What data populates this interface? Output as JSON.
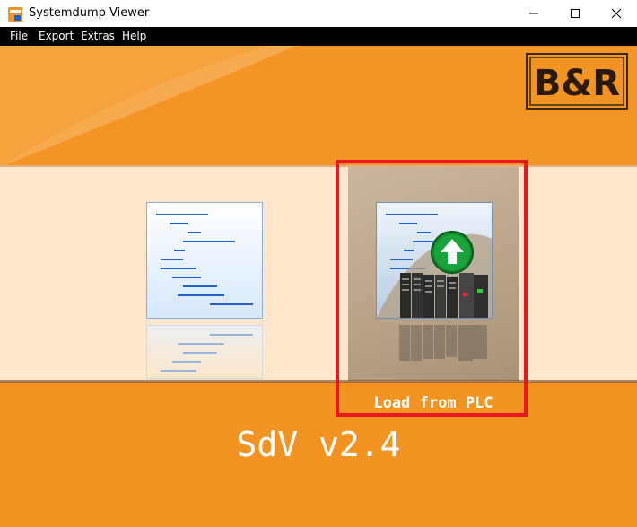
{
  "window": {
    "title": "Systemdump Viewer",
    "minimize_icon": "minimize-icon",
    "maximize_icon": "maximize-icon",
    "close_icon": "close-icon"
  },
  "menu": {
    "items": [
      "File",
      "Export",
      "Extras",
      "Help"
    ]
  },
  "brand": {
    "logo_text": "B&R",
    "accent_color": "#f39321",
    "band_color": "#fde7cc",
    "highlight_color": "#e8191e"
  },
  "tiles": {
    "open_file_icon": "document-icon",
    "load_from_plc": {
      "label": "Load from PLC",
      "icon": "upload-arrow-icon"
    }
  },
  "footer": {
    "version": "SdV v2.4"
  }
}
